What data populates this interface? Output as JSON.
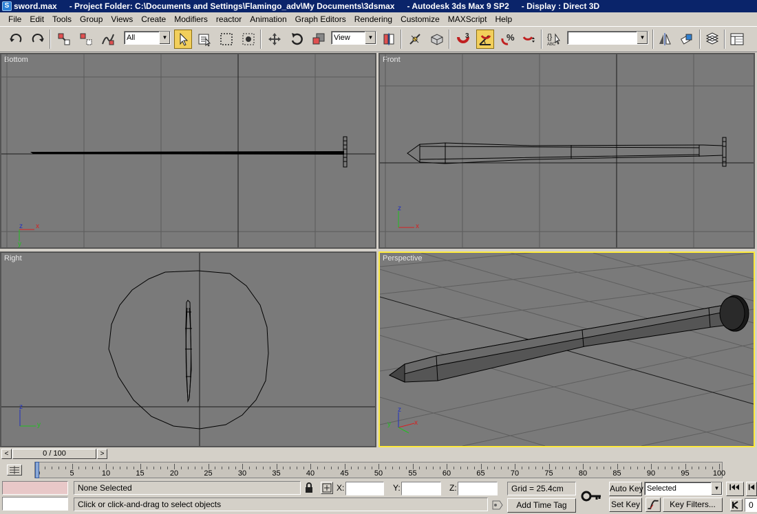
{
  "title": {
    "file": "sword.max",
    "project": "- Project Folder: C:\\Documents and Settings\\Flamingo_adv\\My Documents\\3dsmax",
    "app": "- Autodesk 3ds Max 9 SP2",
    "display": "- Display : Direct 3D"
  },
  "menu": [
    "File",
    "Edit",
    "Tools",
    "Group",
    "Views",
    "Create",
    "Modifiers",
    "reactor",
    "Animation",
    "Graph Editors",
    "Rendering",
    "Customize",
    "MAXScript",
    "Help"
  ],
  "toolbar": {
    "selection_filter": "All",
    "reference_coord": "View",
    "named_selection": "",
    "snap_label": "3",
    "abc_label": "ABC"
  },
  "viewports": {
    "bottom": {
      "label": "Bottom",
      "axis_a": "z",
      "axis_b": "x",
      "axis_c": "y"
    },
    "front": {
      "label": "Front",
      "axis_a": "z",
      "axis_b": "x"
    },
    "right": {
      "label": "Right",
      "axis_a": "z",
      "axis_b": "y"
    },
    "perspective": {
      "label": "Perspective",
      "axis_a": "z",
      "axis_b": "x",
      "axis_c": "y"
    }
  },
  "timeline": {
    "position": "0 / 100",
    "left_arrow": "<",
    "right_arrow": ">",
    "current_frame": 0,
    "total_frames": 100,
    "ticks": [
      "0",
      "5",
      "10",
      "15",
      "20",
      "25",
      "30",
      "35",
      "40",
      "45",
      "50",
      "55",
      "60",
      "65",
      "70",
      "75",
      "80",
      "85",
      "90",
      "95",
      "100"
    ]
  },
  "status": {
    "selection": "None Selected",
    "prompt": "Click or click-and-drag to select objects",
    "x_label": "X:",
    "y_label": "Y:",
    "z_label": "Z:",
    "x_value": "",
    "y_value": "",
    "z_value": "",
    "grid": "Grid = 25.4cm",
    "add_time_tag": "Add Time Tag",
    "auto_key": "Auto Key",
    "set_key": "Set Key",
    "key_mode": "Selected",
    "key_filters": "Key Filters...",
    "frame_field": "0"
  },
  "colors": {
    "viewport_bg": "#7a7a7a",
    "active_border": "#ffeb3b",
    "title_bg": "#0a246a"
  }
}
